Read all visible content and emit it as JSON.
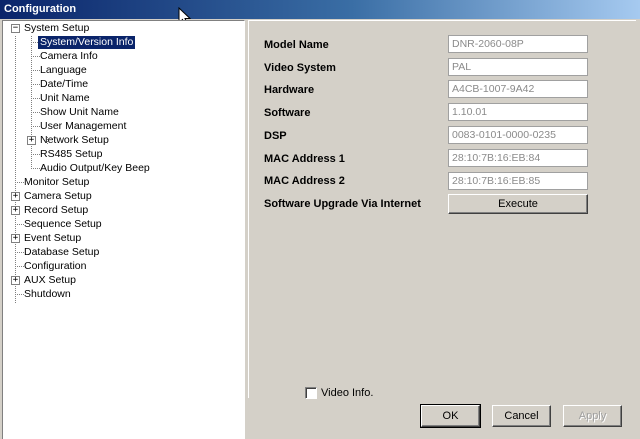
{
  "window": {
    "title": "Configuration"
  },
  "tree": {
    "system_setup": "System Setup",
    "system_version_info": "System/Version Info",
    "camera_info": "Camera Info",
    "language": "Language",
    "date_time": "Date/Time",
    "unit_name": "Unit Name",
    "show_unit_name": "Show Unit Name",
    "user_management": "User Management",
    "network_setup": "Network Setup",
    "rs485_setup": "RS485 Setup",
    "audio_output": "Audio Output/Key Beep",
    "monitor_setup": "Monitor Setup",
    "camera_setup": "Camera Setup",
    "record_setup": "Record Setup",
    "sequence_setup": "Sequence Setup",
    "event_setup": "Event Setup",
    "database_setup": "Database Setup",
    "configuration": "Configuration",
    "aux_setup": "AUX Setup",
    "shutdown": "Shutdown",
    "expanded_symbol": "−",
    "collapsed_symbol": "+"
  },
  "info": {
    "model_name_label": "Model Name",
    "model_name_value": "DNR-2060-08P",
    "video_system_label": "Video System",
    "video_system_value": "PAL",
    "hardware_label": "Hardware",
    "hardware_value": "A4CB-1007-9A42",
    "software_label": "Software",
    "software_value": "1.10.01",
    "dsp_label": "DSP",
    "dsp_value": "0083-0101-0000-0235",
    "mac1_label": "MAC Address 1",
    "mac1_value": "28:10:7B:16:EB:84",
    "mac2_label": "MAC Address 2",
    "mac2_value": "28:10:7B:16:EB:85",
    "upgrade_label": "Software Upgrade Via Internet",
    "execute_label": "Execute"
  },
  "footer": {
    "video_info_label": "Video Info.",
    "ok_label": "OK",
    "cancel_label": "Cancel",
    "apply_label": "Apply"
  },
  "colors": {
    "title_start": "#0a246a",
    "title_end": "#a6caf0",
    "face": "#d4d0c8",
    "selection": "#0a246a"
  }
}
